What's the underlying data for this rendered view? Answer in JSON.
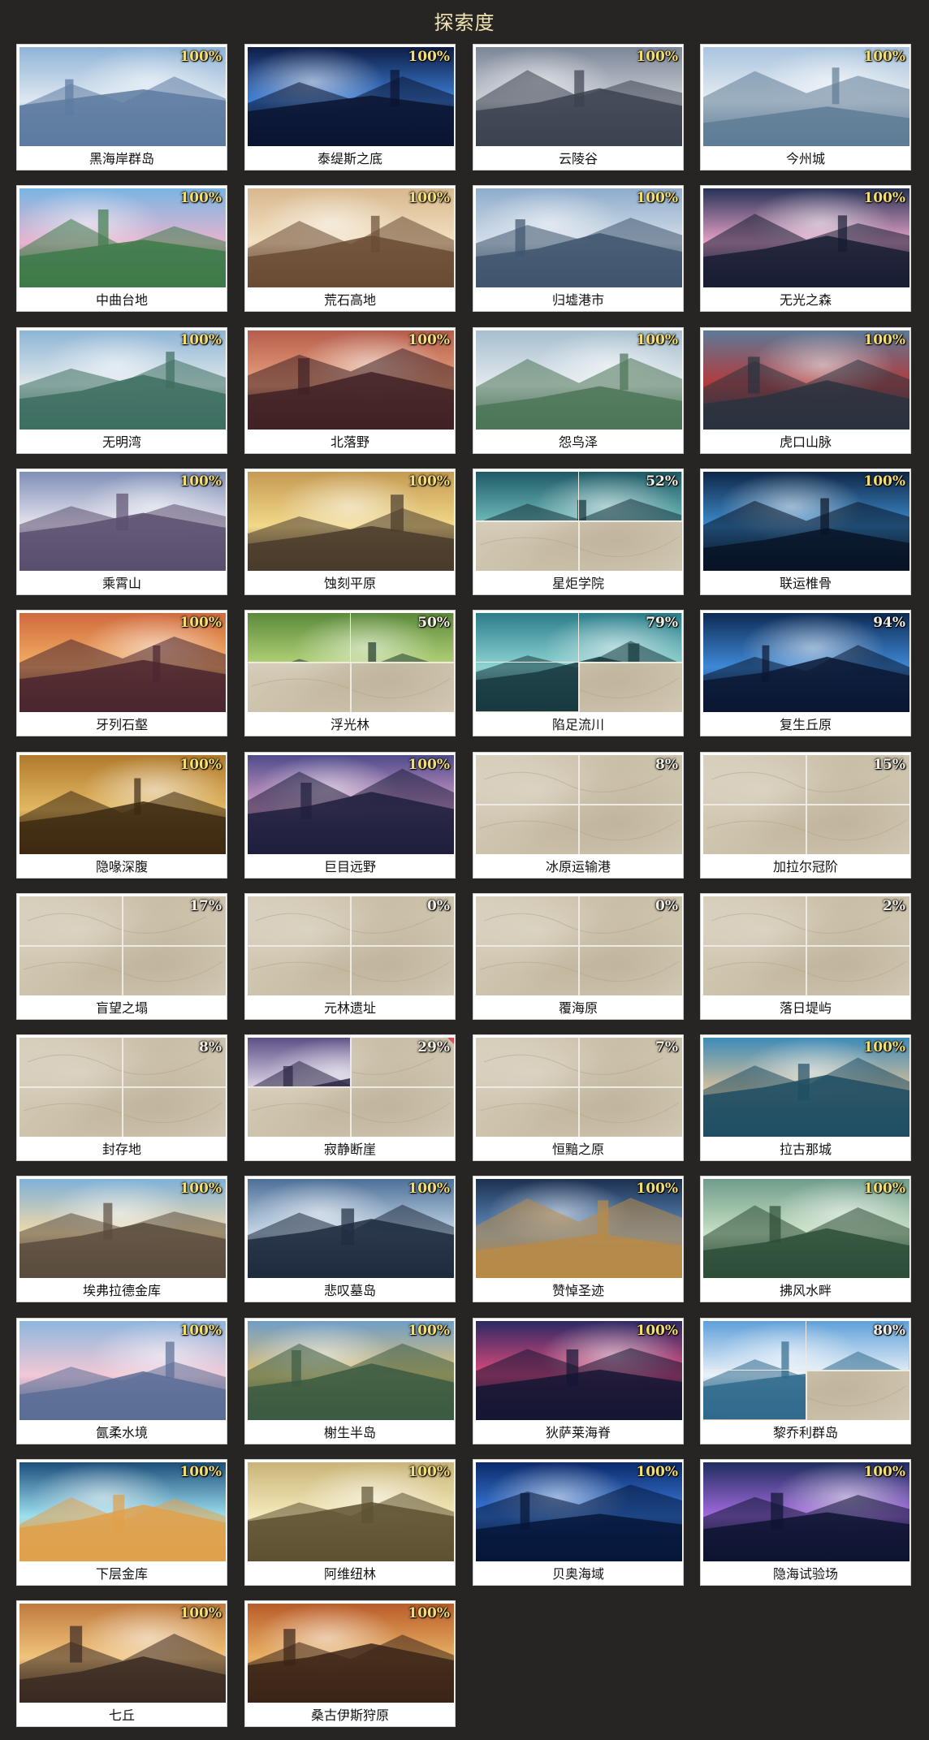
{
  "page_title": "探索度",
  "regions": [
    {
      "name": "黑海岸群岛",
      "percent": "100%",
      "palette": [
        "#8fb4d8",
        "#dfe8f0",
        "#5d7aa0"
      ],
      "fill": 4
    },
    {
      "name": "泰缇斯之底",
      "percent": "100%",
      "palette": [
        "#0e1d45",
        "#3d7fd8",
        "#0b1430"
      ],
      "fill": 4
    },
    {
      "name": "云陵谷",
      "percent": "100%",
      "palette": [
        "#7c8697",
        "#c9cdd3",
        "#3c4250"
      ],
      "fill": 4
    },
    {
      "name": "今州城",
      "percent": "100%",
      "palette": [
        "#a9c4de",
        "#e8edf2",
        "#5f7c96"
      ],
      "fill": 4
    },
    {
      "name": "中曲台地",
      "percent": "100%",
      "palette": [
        "#79b5e3",
        "#e7b4cf",
        "#3d7a48"
      ],
      "fill": 4
    },
    {
      "name": "荒石高地",
      "percent": "100%",
      "palette": [
        "#d8b88f",
        "#f2e1c1",
        "#6a4b34"
      ],
      "fill": 4
    },
    {
      "name": "归墟港市",
      "percent": "100%",
      "palette": [
        "#8eaccc",
        "#d4dde8",
        "#3f556d"
      ],
      "fill": 4
    },
    {
      "name": "无光之森",
      "percent": "100%",
      "palette": [
        "#273256",
        "#e7a3c7",
        "#171d33"
      ],
      "fill": 4
    },
    {
      "name": "无明湾",
      "percent": "100%",
      "palette": [
        "#8eb5d6",
        "#dfe7ea",
        "#3d6e60"
      ],
      "fill": 4
    },
    {
      "name": "北落野",
      "percent": "100%",
      "palette": [
        "#b55d4d",
        "#e9a37c",
        "#402125"
      ],
      "fill": 4
    },
    {
      "name": "怨鸟泽",
      "percent": "100%",
      "palette": [
        "#a6bfcf",
        "#e3e9ed",
        "#4c7557"
      ],
      "fill": 4
    },
    {
      "name": "虎口山脉",
      "percent": "100%",
      "palette": [
        "#5d7a98",
        "#b43a3a",
        "#2a3340"
      ],
      "fill": 4
    },
    {
      "name": "乘霄山",
      "percent": "100%",
      "palette": [
        "#7f8fb8",
        "#e8e6ee",
        "#5b4f6f"
      ],
      "fill": 4
    },
    {
      "name": "蚀刻平原",
      "percent": "100%",
      "palette": [
        "#c59a52",
        "#f1d98a",
        "#4a3b2b"
      ],
      "fill": 4
    },
    {
      "name": "星炬学院",
      "percent": "52%",
      "palette": [
        "#1f5a66",
        "#74c1c0",
        "#16333c"
      ],
      "fill": 2
    },
    {
      "name": "联运椎骨",
      "percent": "100%",
      "palette": [
        "#0f2748",
        "#3d8ccc",
        "#081426"
      ],
      "fill": 4
    },
    {
      "name": "牙列石壑",
      "percent": "100%",
      "palette": [
        "#d06a3e",
        "#f4b065",
        "#4b2630"
      ],
      "fill": 4
    },
    {
      "name": "浮光林",
      "percent": "50%",
      "palette": [
        "#5b8a3b",
        "#b7d67a",
        "#1f3a2a"
      ],
      "fill": 2
    },
    {
      "name": "陷足流川",
      "percent": "79%",
      "palette": [
        "#2b7d8a",
        "#8ed4d2",
        "#173a3f"
      ],
      "fill": 3
    },
    {
      "name": "复生丘原",
      "percent": "94%",
      "palette": [
        "#0d2b55",
        "#3f89d6",
        "#0a1732"
      ],
      "fill": 4
    },
    {
      "name": "隐喙深腹",
      "percent": "100%",
      "palette": [
        "#b07a2c",
        "#e3b862",
        "#3d2a12"
      ],
      "fill": 4
    },
    {
      "name": "巨目远野",
      "percent": "100%",
      "palette": [
        "#4e4b8b",
        "#d9a0c9",
        "#1f1f3d"
      ],
      "fill": 4
    },
    {
      "name": "冰原运输港",
      "percent": "8%",
      "palette": [
        "#d0c6b2",
        "#e2dacb",
        "#bdb19a"
      ],
      "fill": 0
    },
    {
      "name": "加拉尔冠阶",
      "percent": "15%",
      "palette": [
        "#d0c6b2",
        "#e2dacb",
        "#bdb19a"
      ],
      "fill": 0
    },
    {
      "name": "盲望之塌",
      "percent": "17%",
      "palette": [
        "#d0c6b2",
        "#e2dacb",
        "#bdb19a"
      ],
      "fill": 0
    },
    {
      "name": "元林遗址",
      "percent": "0%",
      "palette": [
        "#d0c6b2",
        "#e2dacb",
        "#bdb19a"
      ],
      "fill": 0
    },
    {
      "name": "覆海原",
      "percent": "0%",
      "palette": [
        "#d0c6b2",
        "#e2dacb",
        "#bdb19a"
      ],
      "fill": 0
    },
    {
      "name": "落日堤屿",
      "percent": "2%",
      "palette": [
        "#d0c6b2",
        "#e2dacb",
        "#bdb19a"
      ],
      "fill": 0
    },
    {
      "name": "封存地",
      "percent": "8%",
      "palette": [
        "#d0c6b2",
        "#e2dacb",
        "#bdb19a"
      ],
      "fill": 0
    },
    {
      "name": "寂静断崖",
      "percent": "29%",
      "palette": [
        "#5c4f86",
        "#e8dff0",
        "#2b2745"
      ],
      "fill": 1,
      "flag": true
    },
    {
      "name": "恒黯之原",
      "percent": "7%",
      "palette": [
        "#d0c6b2",
        "#e2dacb",
        "#bdb19a"
      ],
      "fill": 0
    },
    {
      "name": "拉古那城",
      "percent": "100%",
      "palette": [
        "#3e8bb8",
        "#dcc29a",
        "#1f4d63"
      ],
      "fill": 4
    },
    {
      "name": "埃弗拉德金库",
      "percent": "100%",
      "palette": [
        "#7fb1d9",
        "#f0d9a9",
        "#5a4c3e"
      ],
      "fill": 4
    },
    {
      "name": "悲叹墓岛",
      "percent": "100%",
      "palette": [
        "#4d6f98",
        "#c4d6e6",
        "#1f2c40"
      ],
      "fill": 4
    },
    {
      "name": "赞悼圣迹",
      "percent": "100%",
      "palette": [
        "#1d3150",
        "#5f8cc0",
        "#b98a46"
      ],
      "fill": 4
    },
    {
      "name": "拂风水畔",
      "percent": "100%",
      "palette": [
        "#6f9c8c",
        "#c7e0c2",
        "#2d4d38"
      ],
      "fill": 4
    },
    {
      "name": "氤柔水境",
      "percent": "100%",
      "palette": [
        "#8fb6dd",
        "#f2c8d6",
        "#5a6d95"
      ],
      "fill": 4
    },
    {
      "name": "榭生半岛",
      "percent": "100%",
      "palette": [
        "#6f9dc6",
        "#e2c172",
        "#3b5b42"
      ],
      "fill": 4
    },
    {
      "name": "狄萨莱海脊",
      "percent": "100%",
      "palette": [
        "#2c2a63",
        "#e04a7c",
        "#141633"
      ],
      "fill": 4
    },
    {
      "name": "黎乔利群岛",
      "percent": "80%",
      "palette": [
        "#5fa0d9",
        "#e9f1f8",
        "#2f6a8c"
      ],
      "fill": 3
    },
    {
      "name": "下层金库",
      "percent": "100%",
      "palette": [
        "#1c4e7b",
        "#9ee0ef",
        "#e1a04a"
      ],
      "fill": 4
    },
    {
      "name": "阿维纽林",
      "percent": "100%",
      "palette": [
        "#c9b478",
        "#f4ebbd",
        "#5d5131"
      ],
      "fill": 4
    },
    {
      "name": "贝奥海域",
      "percent": "100%",
      "palette": [
        "#0c2a6a",
        "#3b7fe0",
        "#061638"
      ],
      "fill": 4
    },
    {
      "name": "隐海试验场",
      "percent": "100%",
      "palette": [
        "#1f2d5e",
        "#a46be0",
        "#0d1430"
      ],
      "fill": 4
    },
    {
      "name": "七丘",
      "percent": "100%",
      "palette": [
        "#c07a3e",
        "#f1c47c",
        "#3a2a22"
      ],
      "fill": 4
    },
    {
      "name": "桑古伊斯狩原",
      "percent": "100%",
      "palette": [
        "#b95c2a",
        "#e9b164",
        "#3b2418"
      ],
      "fill": 4
    }
  ]
}
